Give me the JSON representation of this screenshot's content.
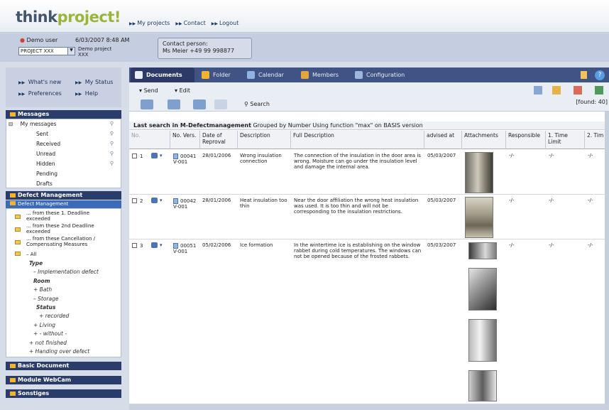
{
  "app": {
    "logo_main": "think",
    "logo_accent": "project!",
    "topnav": [
      "My projects",
      "Contact",
      "Logout"
    ]
  },
  "info": {
    "user": "Demo user",
    "date": "6/03/2007 8:48 AM",
    "project_select": "PROJECT XXX",
    "project_name": "Demo project XXX",
    "contact_label": "Contact person:",
    "contact_value": "Ms Meier +49 99 998877"
  },
  "quicklinks": [
    "What's new",
    "My Status",
    "Preferences",
    "Help"
  ],
  "messages": {
    "header": "Messages",
    "root": "My messages",
    "items": [
      "Sent",
      "Received",
      "Unread",
      "Hidden",
      "Pending",
      "Drafts"
    ]
  },
  "defect": {
    "header": "Defect Management",
    "subheader": "Defect Management",
    "items": [
      "... from these 1. Deadline exceeded",
      "... from these 2nd Deadline exceeded",
      "... from these Cancellation / Compensating Measures",
      "All"
    ],
    "tree": [
      "Type",
      "Implementation defect",
      "Room",
      "Bath",
      "Storage",
      "Status",
      "recorded",
      "Living",
      "- without -",
      "not finished",
      "Handing over defect"
    ]
  },
  "sections": [
    "Basic Document",
    "Module WebCam",
    "Sonstiges"
  ],
  "tabs": [
    "Documents",
    "Folder",
    "Calendar",
    "Members",
    "Configuration"
  ],
  "toolbar": {
    "send": "Send",
    "edit": "Edit",
    "search": "Search",
    "found": "[found: 40]"
  },
  "search_header": {
    "bold": "Last search in M-Defectmanagement",
    "rest": " Grouped by Number Using function \"max\" on BASIS version"
  },
  "columns": [
    "No.",
    "No. Vers.",
    "Date of Reproval",
    "Description",
    "Full Description",
    "advised at",
    "Attachments",
    "Responsible",
    "1. Time Limit",
    "2. Tim"
  ],
  "rows": [
    {
      "n": "1",
      "no": "00041",
      "vers": "V-001",
      "date": "28/01/2006",
      "desc": "Wrong insulation connection",
      "full": "The connection of the insulation in the door area is wrong. Moisture can go under the insulation level and damage the internal area.",
      "adv": "05/03/2007",
      "resp": "-/-",
      "t1": "-/-",
      "t2": "-/-"
    },
    {
      "n": "2",
      "no": "00042",
      "vers": "V-001",
      "date": "28/01/2006",
      "desc": "Heat insulation too thin",
      "full": "Near the door affiliation the wrong heat insulation was used. It is too thin and will not be corresponding to the insulation restrictions.",
      "adv": "05/03/2007",
      "resp": "-/-",
      "t1": "-/-",
      "t2": "-/-"
    },
    {
      "n": "3",
      "no": "00051",
      "vers": "V-001",
      "date": "05/02/2006",
      "desc": "Ice formation",
      "full": "In the wintertime ice is establishing on the window rabbet during cold temperatures. The windows can not be opened because of the frosted rabbets.",
      "adv": "05/03/2007",
      "resp": "-/-",
      "t1": "-/-",
      "t2": "-/-"
    }
  ]
}
